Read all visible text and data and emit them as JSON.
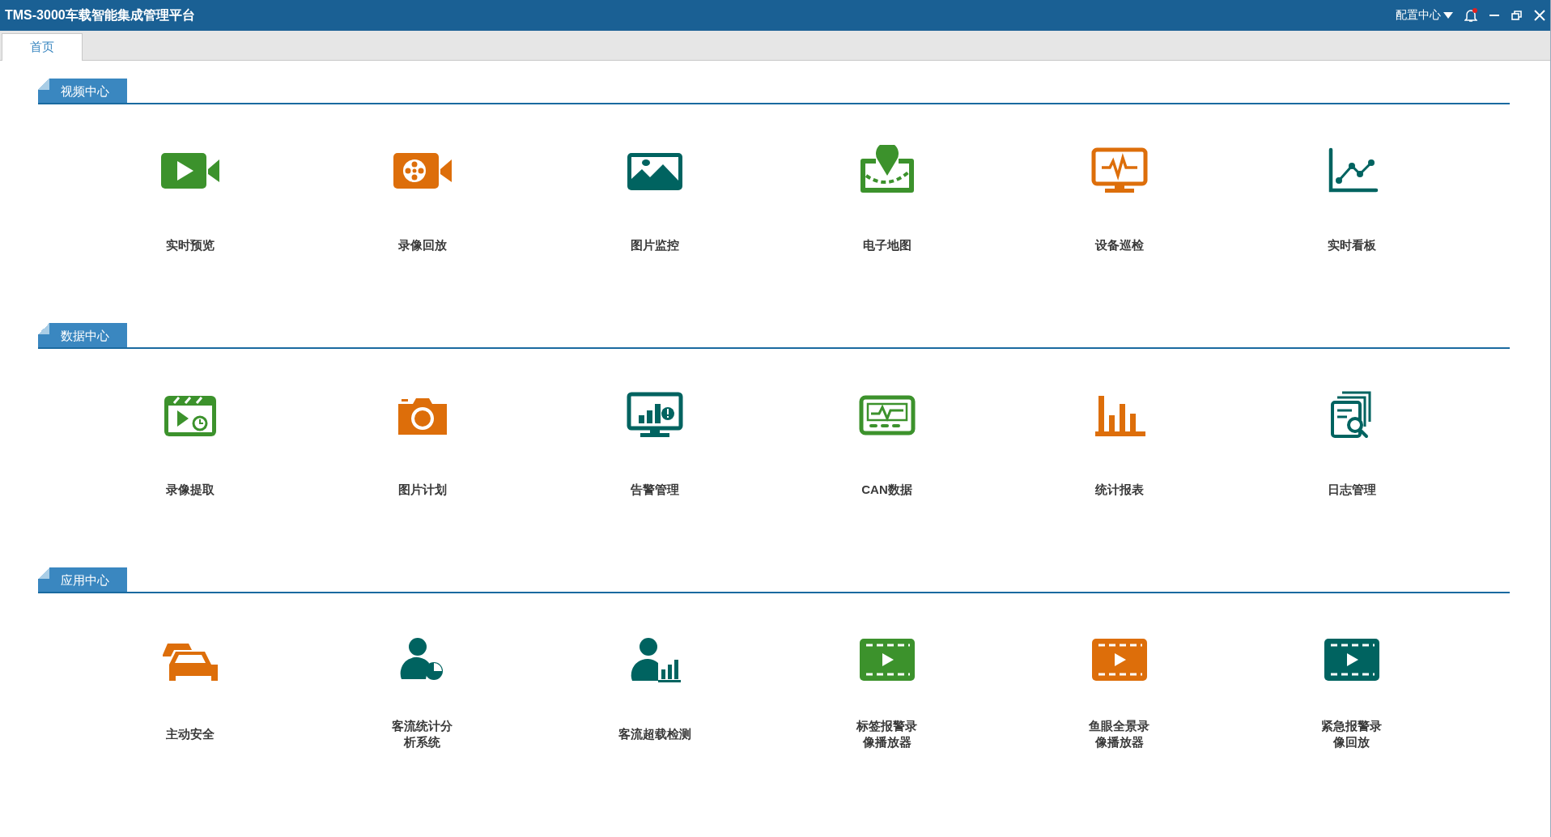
{
  "window": {
    "title": "TMS-3000车载智能集成管理平台",
    "config_menu": "配置中心",
    "notification_unread": true
  },
  "tabs": [
    {
      "label": "首页",
      "selected": true
    }
  ],
  "sections": [
    {
      "title": "视频中心",
      "items": [
        {
          "lines": [
            "实时预览"
          ],
          "color": "#3c922c"
        },
        {
          "lines": [
            "录像回放"
          ],
          "color": "#dd6e0a"
        },
        {
          "lines": [
            "图片监控"
          ],
          "color": "#006360"
        },
        {
          "lines": [
            "电子地图"
          ],
          "color": "#3c922c"
        },
        {
          "lines": [
            "设备巡检"
          ],
          "color": "#dd6e0a"
        },
        {
          "lines": [
            "实时看板"
          ],
          "color": "#006360"
        }
      ]
    },
    {
      "title": "数据中心",
      "items": [
        {
          "lines": [
            "录像提取"
          ],
          "color": "#3c922c"
        },
        {
          "lines": [
            "图片计划"
          ],
          "color": "#dd6e0a"
        },
        {
          "lines": [
            "告警管理"
          ],
          "color": "#006360"
        },
        {
          "lines": [
            "CAN数据"
          ],
          "color": "#3c922c"
        },
        {
          "lines": [
            "统计报表"
          ],
          "color": "#dd6e0a"
        },
        {
          "lines": [
            "日志管理"
          ],
          "color": "#006360"
        }
      ]
    },
    {
      "title": "应用中心",
      "items": [
        {
          "lines": [
            "主动安全"
          ],
          "color": "#dd6e0a"
        },
        {
          "lines": [
            "客流统计分",
            "析系统"
          ],
          "color": "#006360"
        },
        {
          "lines": [
            "客流超载检测"
          ],
          "color": "#006360"
        },
        {
          "lines": [
            "标签报警录",
            "像播放器"
          ],
          "color": "#3c922c"
        },
        {
          "lines": [
            "鱼眼全景录",
            "像播放器"
          ],
          "color": "#dd6e0a"
        },
        {
          "lines": [
            "紧急报警录",
            "像回放"
          ],
          "color": "#006360"
        }
      ]
    }
  ]
}
